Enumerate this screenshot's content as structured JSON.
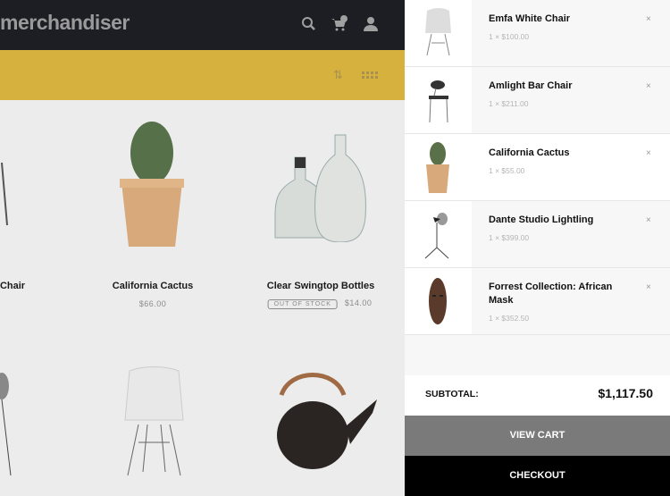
{
  "header": {
    "logo": "merchandiser",
    "icons": [
      "search-icon",
      "cart-icon",
      "user-icon"
    ],
    "cart_count": "0"
  },
  "toolbar": {
    "icons": [
      "sort-icon",
      "grid-view-icon"
    ]
  },
  "products": [
    {
      "name": "Chair",
      "price": ""
    },
    {
      "name": "California Cactus",
      "price": "$66.00"
    },
    {
      "name": "Clear Swingtop Bottles",
      "price": "$14.00",
      "badge": "OUT OF STOCK"
    }
  ],
  "cart": {
    "items": [
      {
        "name": "Emfa White Chair",
        "qty": "1 × $100.00"
      },
      {
        "name": "Amlight Bar Chair",
        "qty": "1 × $211.00"
      },
      {
        "name": "California Cactus",
        "qty": "1 × $55.00"
      },
      {
        "name": "Dante Studio Lightling",
        "qty": "1 × $399.00"
      },
      {
        "name": "Forrest Collection: African Mask",
        "qty": "1 × $352.50"
      }
    ],
    "remove_label": "×",
    "subtotal_label": "SUBTOTAL:",
    "subtotal": "$1,117.50",
    "view_cart": "VIEW CART",
    "checkout": "CHECKOUT"
  },
  "colors": {
    "header": "#1d1e23",
    "band": "#d7b13d",
    "view_cart": "#7a7a7a",
    "checkout": "#000000"
  }
}
